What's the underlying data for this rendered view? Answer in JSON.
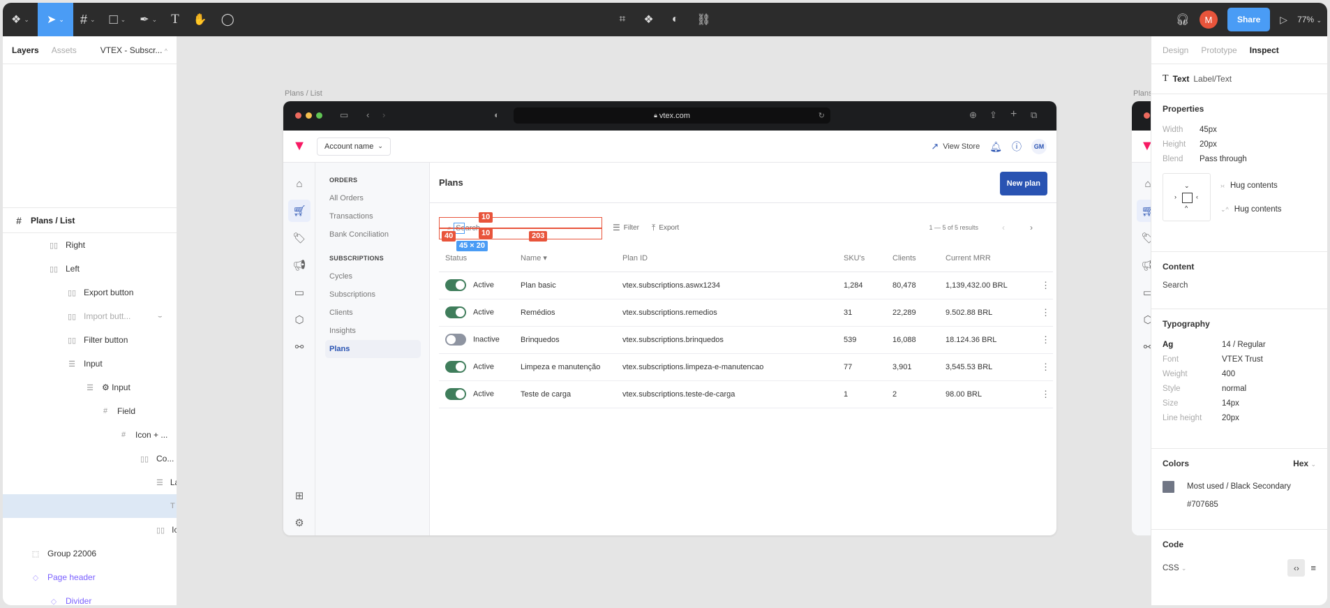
{
  "toolbar": {
    "tools": [
      {
        "name": "main-menu",
        "icon": "figma-logo-icon",
        "glyph": "❖"
      },
      {
        "name": "move-tool",
        "icon": "cursor-icon",
        "glyph": "➤",
        "active": true
      },
      {
        "name": "frame-tool",
        "icon": "frame-icon",
        "glyph": "#"
      },
      {
        "name": "shape-tool",
        "icon": "rectangle-icon",
        "glyph": "□"
      },
      {
        "name": "pen-tool",
        "icon": "pen-icon",
        "glyph": "✒"
      },
      {
        "name": "text-tool",
        "icon": "text-icon",
        "glyph": "T"
      },
      {
        "name": "hand-tool",
        "icon": "hand-icon",
        "glyph": "✋"
      },
      {
        "name": "comment-tool",
        "icon": "comment-icon",
        "glyph": "◯"
      }
    ],
    "center_tools": [
      {
        "name": "edit-object",
        "icon": "edit-object-icon",
        "glyph": "⌗"
      },
      {
        "name": "components",
        "icon": "components-icon",
        "glyph": "❖"
      },
      {
        "name": "mask",
        "icon": "mask-icon",
        "glyph": "◐"
      },
      {
        "name": "link",
        "icon": "link-icon",
        "glyph": "⛓"
      }
    ],
    "avatar_initial": "M",
    "share_label": "Share",
    "zoom_level": "77%"
  },
  "left_panel": {
    "tab_layers": "Layers",
    "tab_assets": "Assets",
    "page_name": "VTEX - Subscr...",
    "frame_name": "Plans / List",
    "layers": [
      {
        "label": "Right",
        "icon": "▯▯",
        "indent": 1
      },
      {
        "label": "Left",
        "icon": "▯▯",
        "indent": 1
      },
      {
        "label": "Export button",
        "icon": "▯▯",
        "indent": 2
      },
      {
        "label": "Import butt...",
        "icon": "▯▯",
        "indent": 2,
        "hidden": true
      },
      {
        "label": "Filter button",
        "icon": "▯▯",
        "indent": 2
      },
      {
        "label": "Input",
        "icon": "☰",
        "indent": 2
      },
      {
        "label": "⚙ Input",
        "icon": "☰",
        "indent": 3
      },
      {
        "label": "Field",
        "icon": "#",
        "indent": 4
      },
      {
        "label": "Icon + ...",
        "icon": "#",
        "indent": 5
      },
      {
        "label": "Co...",
        "icon": "▯▯",
        "indent": 6
      },
      {
        "label": "La",
        "icon": "☰",
        "indent": 7
      },
      {
        "label": "",
        "icon": "T",
        "indent": 8,
        "selected": true
      },
      {
        "label": "Ic",
        "icon": "▯▯",
        "indent": 7
      },
      {
        "label": "Group 22006",
        "icon": "⬚",
        "indent": 0
      },
      {
        "label": "Page header",
        "icon": "◇",
        "indent": 0,
        "component": true
      },
      {
        "label": "Divider",
        "icon": "◇",
        "indent": 1,
        "component": true
      }
    ]
  },
  "canvas": {
    "frame_label": "Plans / List",
    "frame_label_2": "Plans",
    "browser": {
      "url": "vtex.com",
      "account_name": "Account name",
      "view_store": "View Store",
      "user_initials": "GM",
      "subnav": {
        "orders_heading": "ORDERS",
        "orders_items": [
          "All Orders",
          "Transactions",
          "Bank Conciliation"
        ],
        "subs_heading": "SUBSCRIPTIONS",
        "subs_items": [
          "Cycles",
          "Subscriptions",
          "Clients",
          "Insights",
          "Plans"
        ],
        "active_item": "Plans"
      },
      "page_title": "Plans",
      "new_plan_label": "New plan",
      "search_placeholder": "Search",
      "filter_label": "Filter",
      "export_label": "Export",
      "pagination_text": "1 — 5 of 5 results",
      "measurements": {
        "top": "10",
        "bottom": "10",
        "left": "40",
        "right": "203",
        "size": "45 × 20"
      },
      "table": {
        "columns": [
          "Status",
          "Name ▾",
          "Plan ID",
          "SKU's",
          "Clients",
          "Current MRR"
        ],
        "rows": [
          {
            "active": true,
            "status": "Active",
            "name": "Plan basic",
            "plan_id": "vtex.subscriptions.aswx1234",
            "skus": "1,284",
            "clients": "80,478",
            "mrr": "1,139,432.00 BRL"
          },
          {
            "active": true,
            "status": "Active",
            "name": "Remédios",
            "plan_id": "vtex.subscriptions.remedios",
            "skus": "31",
            "clients": "22,289",
            "mrr": "9.502.88 BRL"
          },
          {
            "active": false,
            "status": "Inactive",
            "name": "Brinquedos",
            "plan_id": "vtex.subscriptions.brinquedos",
            "skus": "539",
            "clients": "16,088",
            "mrr": "18.124.36 BRL"
          },
          {
            "active": true,
            "status": "Active",
            "name": "Limpeza e manutenção",
            "plan_id": "vtex.subscriptions.limpeza-e-manutencao",
            "skus": "77",
            "clients": "3,901",
            "mrr": "3,545.53 BRL"
          },
          {
            "active": true,
            "status": "Active",
            "name": "Teste de carga",
            "plan_id": "vtex.subscriptions.teste-de-carga",
            "skus": "1",
            "clients": "2",
            "mrr": "98.00 BRL"
          }
        ]
      }
    }
  },
  "right_panel": {
    "tabs": {
      "design": "Design",
      "prototype": "Prototype",
      "inspect": "Inspect"
    },
    "layer_type": "Text",
    "layer_name": "Label/Text",
    "properties_title": "Properties",
    "width_label": "Width",
    "width_value": "45px",
    "height_label": "Height",
    "height_value": "20px",
    "blend_label": "Blend",
    "blend_value": "Pass through",
    "hug_h": "Hug contents",
    "hug_v": "Hug contents",
    "content_title": "Content",
    "content_value": "Search",
    "typography_title": "Typography",
    "typo_style_key": "Ag",
    "typo_style_value": "14 / Regular",
    "font_label": "Font",
    "font_value": "VTEX Trust",
    "weight_label": "Weight",
    "weight_value": "400",
    "style_label": "Style",
    "style_value": "normal",
    "size_label": "Size",
    "size_value": "14px",
    "lineheight_label": "Line height",
    "lineheight_value": "20px",
    "colors_title": "Colors",
    "color_format": "Hex",
    "color_name": "Most used / Black Secondary",
    "color_hex": "#707685",
    "code_title": "Code",
    "code_lang": "CSS"
  },
  "colors": {
    "accent": "#4a9cf5",
    "vtex_pink": "#f71963",
    "vtex_blue": "#2953b2",
    "toggle_on": "#3f7d5b",
    "toggle_off": "#8e94a1",
    "measure_red": "#e8543b"
  }
}
